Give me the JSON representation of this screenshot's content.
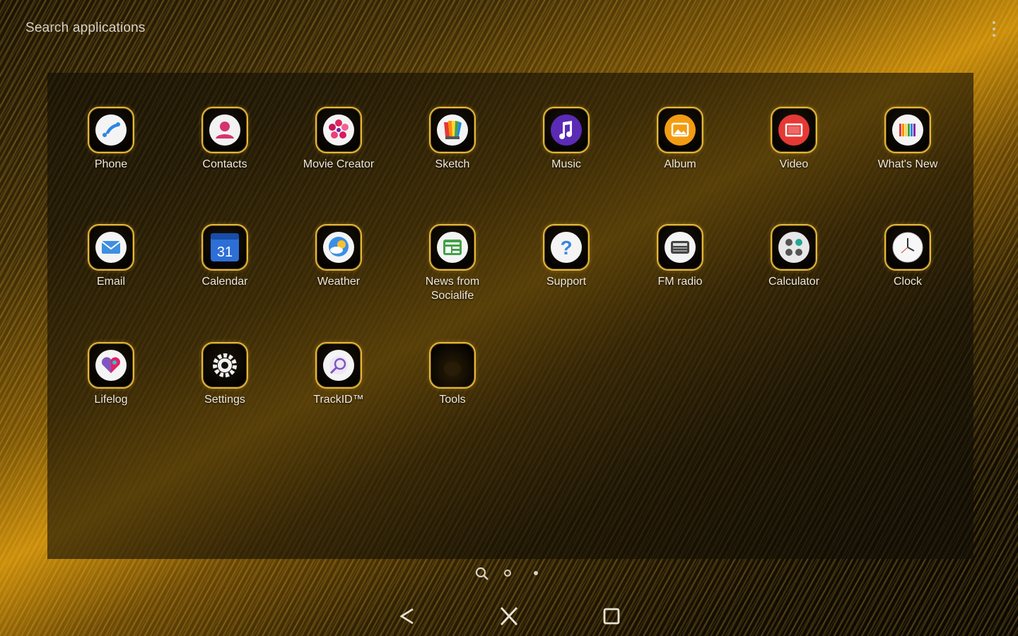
{
  "search": {
    "placeholder": "Search applications"
  },
  "apps": [
    {
      "label": "Phone",
      "icon": "phone-icon"
    },
    {
      "label": "Contacts",
      "icon": "contacts-icon"
    },
    {
      "label": "Movie Creator",
      "icon": "movie-creator-icon"
    },
    {
      "label": "Sketch",
      "icon": "sketch-icon"
    },
    {
      "label": "Music",
      "icon": "music-icon"
    },
    {
      "label": "Album",
      "icon": "album-icon"
    },
    {
      "label": "Video",
      "icon": "video-icon"
    },
    {
      "label": "What's New",
      "icon": "whats-new-icon"
    },
    {
      "label": "Email",
      "icon": "email-icon"
    },
    {
      "label": "Calendar",
      "icon": "calendar-icon",
      "badge": "31"
    },
    {
      "label": "Weather",
      "icon": "weather-icon"
    },
    {
      "label": "News from Socialife",
      "icon": "news-icon"
    },
    {
      "label": "Support",
      "icon": "support-icon"
    },
    {
      "label": "FM radio",
      "icon": "fm-radio-icon"
    },
    {
      "label": "Calculator",
      "icon": "calculator-icon"
    },
    {
      "label": "Clock",
      "icon": "clock-icon"
    },
    {
      "label": "Lifelog",
      "icon": "lifelog-icon"
    },
    {
      "label": "Settings",
      "icon": "settings-icon"
    },
    {
      "label": "TrackID™",
      "icon": "trackid-icon"
    },
    {
      "label": "Tools",
      "icon": "folder-icon"
    }
  ],
  "colors": {
    "accent_gold": "#e4b73a",
    "label_text": "#f1ead8"
  },
  "navigation": {
    "back": "back-icon",
    "home": "home-icon",
    "recents": "recents-icon"
  }
}
